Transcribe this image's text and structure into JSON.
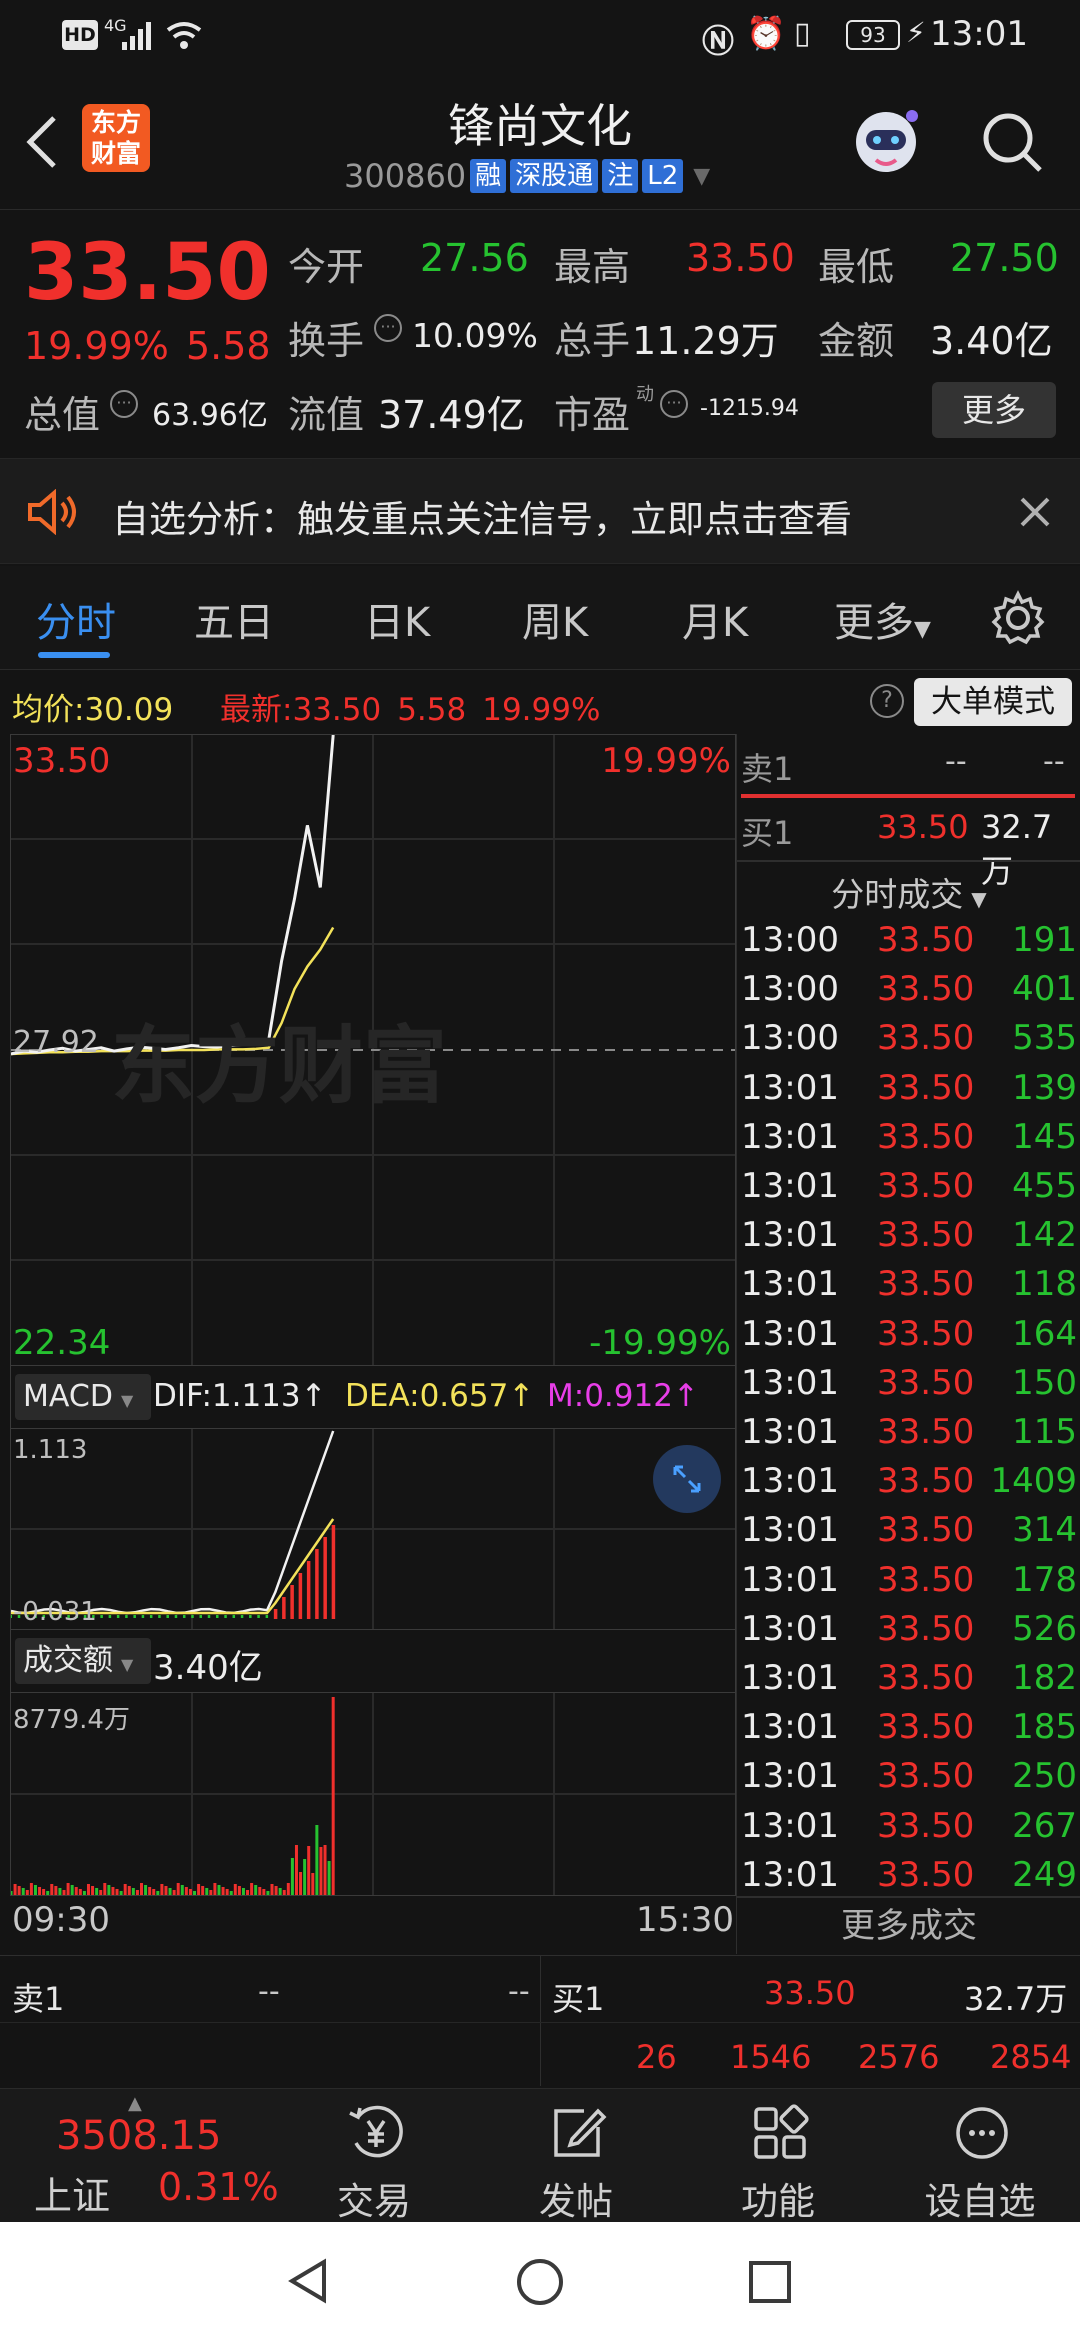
{
  "status": {
    "time": "13:01",
    "battery": "93",
    "network": "4G"
  },
  "header": {
    "logo_line1": "东方",
    "logo_line2": "财富",
    "stock_name": "锋尚文化",
    "stock_code": "300860",
    "tags": [
      "融",
      "深股通",
      "注",
      "L2"
    ]
  },
  "quote": {
    "price": "33.50",
    "change_pct": "19.99%",
    "change": "5.58",
    "stats": [
      {
        "label": "今开",
        "value": "27.56",
        "color": "green"
      },
      {
        "label": "最高",
        "value": "33.50",
        "color": "red"
      },
      {
        "label": "最低",
        "value": "27.50",
        "color": "green"
      },
      {
        "label": "换手",
        "value": "10.09%",
        "color": "white"
      },
      {
        "label": "总手",
        "value": "11.29万",
        "color": "white"
      },
      {
        "label": "金额",
        "value": "3.40亿",
        "color": "white"
      },
      {
        "label": "总值",
        "value": "63.96亿",
        "color": "white"
      },
      {
        "label": "流值",
        "value": "37.49亿",
        "color": "white"
      },
      {
        "label": "市盈",
        "value": "-1215.94",
        "color": "white"
      }
    ],
    "pe_superscript": "动",
    "more_button": "更多"
  },
  "notice": {
    "text": "自选分析：触发重点关注信号，立即点击查看"
  },
  "tabs": [
    "分时",
    "五日",
    "日K",
    "周K",
    "月K",
    "更多"
  ],
  "active_tab": "分时",
  "avgbar": {
    "avg_label": "均价:",
    "avg_value": "30.09",
    "latest_label": "最新:",
    "latest_value": "33.50",
    "latest_change": "5.58",
    "latest_pct": "19.99%",
    "help": "?",
    "big_order_button": "大单模式"
  },
  "main_chart": {
    "y_high": "33.50",
    "y_high_pct": "19.99%",
    "y_mid": "27.92",
    "y_low": "22.34",
    "y_low_pct": "-19.99%",
    "watermark": "东方财富"
  },
  "macd": {
    "selector": "MACD",
    "dif": "DIF:1.113",
    "dea": "DEA:0.657",
    "m": "M:0.912",
    "arrow": "↑",
    "top": "1.113",
    "bottom": "-0.031"
  },
  "volume": {
    "selector": "成交额",
    "value": "3.40亿",
    "top": "8779.4万",
    "time_start": "09:30",
    "time_end": "15:30"
  },
  "colors": {
    "up": "#f0302c",
    "down": "#26c230",
    "accent": "#2f7fe8",
    "avg": "#f3e25a"
  },
  "chart_data": {
    "type": "line",
    "x_range": [
      "09:30",
      "15:30"
    ],
    "ylim": [
      22.34,
      33.5
    ],
    "prev_close": 27.92,
    "series": [],
    "price_path": [
      27.85,
      27.9,
      27.88,
      27.92,
      27.95,
      27.9,
      27.93,
      27.96,
      27.9,
      27.94,
      27.97,
      27.95,
      27.93,
      27.96,
      28.0,
      27.98,
      27.97,
      28.0,
      28.02,
      28.05,
      28.1,
      29.5,
      30.6,
      31.9,
      30.8,
      33.5
    ],
    "avg_path": [
      27.85,
      27.86,
      27.87,
      27.88,
      27.88,
      27.89,
      27.89,
      27.9,
      27.9,
      27.9,
      27.91,
      27.91,
      27.91,
      27.92,
      27.92,
      27.92,
      27.93,
      27.93,
      27.93,
      27.94,
      27.96,
      28.4,
      29.0,
      29.4,
      29.7,
      30.09
    ]
  },
  "right_panel": {
    "sell1_label": "卖1",
    "sell1_price": "--",
    "sell1_vol": "--",
    "buy1_label": "买1",
    "buy1_price": "33.50",
    "buy1_vol": "32.7万",
    "trades_header": "分时成交",
    "trades": [
      {
        "t": "13:00",
        "p": "33.50",
        "v": "191",
        "c": "green"
      },
      {
        "t": "13:00",
        "p": "33.50",
        "v": "401",
        "c": "green"
      },
      {
        "t": "13:00",
        "p": "33.50",
        "v": "535",
        "c": "green"
      },
      {
        "t": "13:01",
        "p": "33.50",
        "v": "139",
        "c": "green"
      },
      {
        "t": "13:01",
        "p": "33.50",
        "v": "145",
        "c": "green"
      },
      {
        "t": "13:01",
        "p": "33.50",
        "v": "455",
        "c": "green"
      },
      {
        "t": "13:01",
        "p": "33.50",
        "v": "142",
        "c": "green"
      },
      {
        "t": "13:01",
        "p": "33.50",
        "v": "118",
        "c": "green"
      },
      {
        "t": "13:01",
        "p": "33.50",
        "v": "164",
        "c": "green"
      },
      {
        "t": "13:01",
        "p": "33.50",
        "v": "150",
        "c": "green"
      },
      {
        "t": "13:01",
        "p": "33.50",
        "v": "115",
        "c": "green"
      },
      {
        "t": "13:01",
        "p": "33.50",
        "v": "1409",
        "c": "green"
      },
      {
        "t": "13:01",
        "p": "33.50",
        "v": "314",
        "c": "green"
      },
      {
        "t": "13:01",
        "p": "33.50",
        "v": "178",
        "c": "green"
      },
      {
        "t": "13:01",
        "p": "33.50",
        "v": "526",
        "c": "green"
      },
      {
        "t": "13:01",
        "p": "33.50",
        "v": "182",
        "c": "green"
      },
      {
        "t": "13:01",
        "p": "33.50",
        "v": "185",
        "c": "green"
      },
      {
        "t": "13:01",
        "p": "33.50",
        "v": "250",
        "c": "green"
      },
      {
        "t": "13:01",
        "p": "33.50",
        "v": "267",
        "c": "green"
      },
      {
        "t": "13:01",
        "p": "33.50",
        "v": "249",
        "c": "green"
      }
    ],
    "more_trades": "更多成交"
  },
  "orderbook": {
    "sell1_label": "卖1",
    "sell1_price": "--",
    "sell1_vol": "--",
    "buy1_label": "买1",
    "buy1_price": "33.50",
    "buy1_vol": "32.7万",
    "queue": [
      "26",
      "1546",
      "2576",
      "2854"
    ]
  },
  "bottom_nav": {
    "index_value": "3508.15",
    "index_name": "上证",
    "index_pct": "0.31%",
    "items": [
      "交易",
      "发帖",
      "功能",
      "设自选"
    ]
  }
}
